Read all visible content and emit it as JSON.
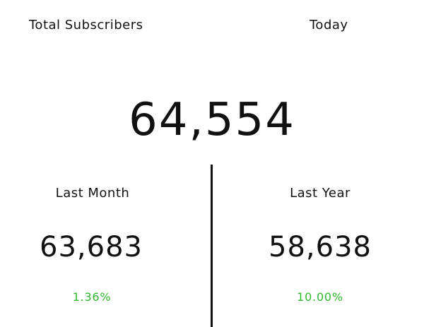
{
  "widget": {
    "title": "Total Subscribers",
    "period": "Today",
    "total_value": "64,554"
  },
  "comparisons": [
    {
      "label": "Last Month",
      "value": "63,683",
      "change": "1.36%"
    },
    {
      "label": "Last Year",
      "value": "58,638",
      "change": "10.00%"
    }
  ],
  "colors": {
    "text": "#111111",
    "positive_change": "#2fb82f",
    "background": "#ffffff",
    "divider": "#111111"
  }
}
